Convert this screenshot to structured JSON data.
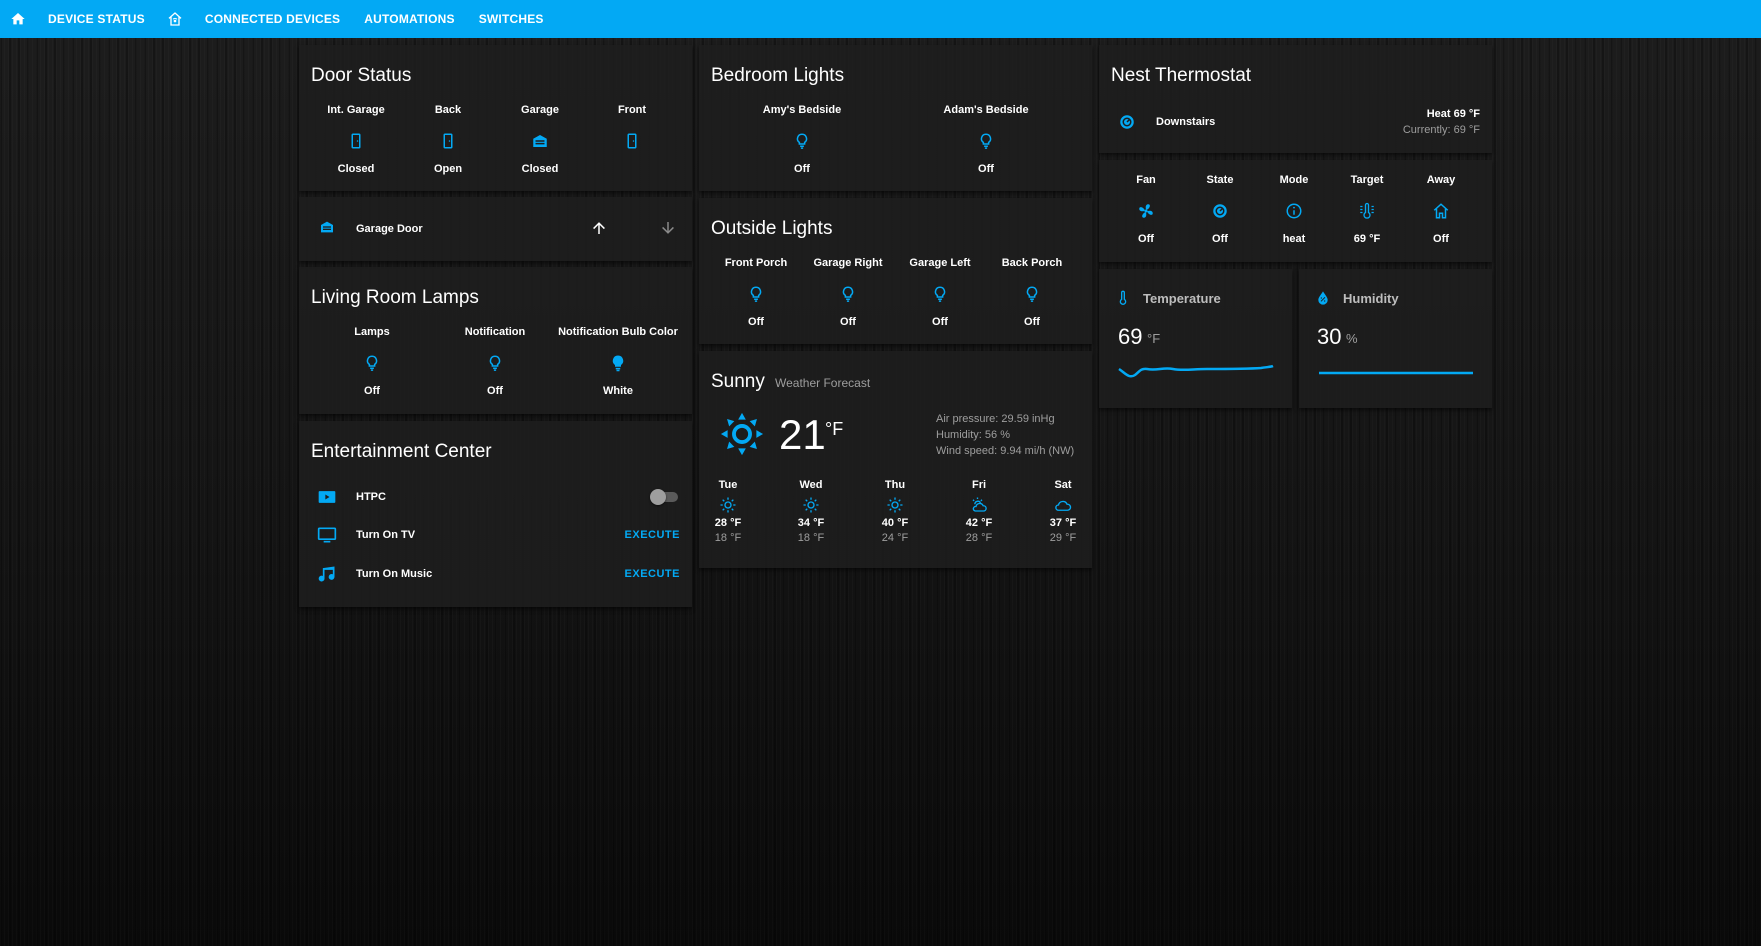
{
  "colors": {
    "accent": "#03a9f4",
    "card": "#1e1e1e",
    "muted": "#9e9e9e"
  },
  "topbar": {
    "home_icon": "home-icon",
    "tabs": [
      "Device Status",
      "Connected Devices",
      "Automations",
      "Switches"
    ],
    "home_automation_icon": "home-automation-icon"
  },
  "door_status": {
    "title": "Door Status",
    "items": [
      {
        "name": "Int. Garage",
        "state": "Closed",
        "icon": "door-icon"
      },
      {
        "name": "Back",
        "state": "Open",
        "icon": "door-icon"
      },
      {
        "name": "Garage",
        "state": "Closed",
        "icon": "garage-icon"
      },
      {
        "name": "Front",
        "state": "",
        "icon": "door-icon"
      }
    ]
  },
  "garage_cover": {
    "label": "Garage Door",
    "icon": "garage-icon",
    "up": "arrow-up-icon",
    "down": "arrow-down-icon"
  },
  "living_room": {
    "title": "Living Room Lamps",
    "items": [
      {
        "name": "Lamps",
        "state": "Off"
      },
      {
        "name": "Notification",
        "state": "Off"
      },
      {
        "name": "Notification Bulb Color",
        "state": "White"
      }
    ]
  },
  "entertainment": {
    "title": "Entertainment Center",
    "rows": [
      {
        "label": "HTPC",
        "icon": "play-box-icon",
        "control": "toggle",
        "on": false
      },
      {
        "label": "Turn On TV",
        "icon": "tv-icon",
        "control": "EXECUTE"
      },
      {
        "label": "Turn On Music",
        "icon": "music-note-icon",
        "control": "EXECUTE"
      }
    ]
  },
  "bedroom": {
    "title": "Bedroom Lights",
    "items": [
      {
        "name": "Amy's Bedside",
        "state": "Off"
      },
      {
        "name": "Adam's Bedside",
        "state": "Off"
      }
    ]
  },
  "outside": {
    "title": "Outside Lights",
    "items": [
      {
        "name": "Front Porch",
        "state": "Off"
      },
      {
        "name": "Garage Right",
        "state": "Off"
      },
      {
        "name": "Garage Left",
        "state": "Off"
      },
      {
        "name": "Back Porch",
        "state": "Off"
      }
    ]
  },
  "weather": {
    "condition": "Sunny",
    "subtitle": "Weather Forecast",
    "temp": "21",
    "unit": "°F",
    "air_pressure": "Air pressure: 29.59 inHg",
    "humidity": "Humidity: 56 %",
    "wind": "Wind speed: 9.94 mi/h (NW)",
    "forecast": [
      {
        "day": "Tue",
        "hi": "28 °F",
        "lo": "18 °F",
        "icon": "sunny-icon"
      },
      {
        "day": "Wed",
        "hi": "34 °F",
        "lo": "18 °F",
        "icon": "sunny-icon"
      },
      {
        "day": "Thu",
        "hi": "40 °F",
        "lo": "24 °F",
        "icon": "sunny-icon"
      },
      {
        "day": "Fri",
        "hi": "42 °F",
        "lo": "28 °F",
        "icon": "partly-cloudy-icon"
      },
      {
        "day": "Sat",
        "hi": "37 °F",
        "lo": "29 °F",
        "icon": "cloudy-icon"
      }
    ]
  },
  "nest": {
    "title": "Nest Thermostat",
    "name": "Downstairs",
    "mode_text": "Heat 69 °F",
    "current": "Currently: 69 °F",
    "items": [
      {
        "name": "Fan",
        "state": "Off",
        "icon": "fan-icon"
      },
      {
        "name": "State",
        "state": "Off",
        "icon": "nest-icon"
      },
      {
        "name": "Mode",
        "state": "heat",
        "icon": "info-icon"
      },
      {
        "name": "Target",
        "state": "69 °F",
        "icon": "thermometer-lines-icon"
      },
      {
        "name": "Away",
        "state": "Off",
        "icon": "home-outline-icon"
      }
    ]
  },
  "temperature": {
    "name": "Temperature",
    "value": "69",
    "unit": "°F",
    "icon": "thermometer-icon"
  },
  "humidity": {
    "name": "Humidity",
    "value": "30",
    "unit": "%",
    "icon": "water-percent-icon"
  }
}
